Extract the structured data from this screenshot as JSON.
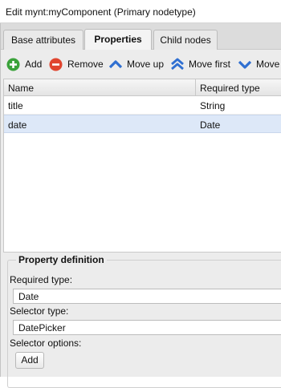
{
  "window": {
    "title": "Edit mynt:myComponent (Primary nodetype)"
  },
  "tabs": [
    {
      "label": "Base attributes",
      "active": false
    },
    {
      "label": "Properties",
      "active": true
    },
    {
      "label": "Child nodes",
      "active": false
    }
  ],
  "toolbar": {
    "add": {
      "label": "Add",
      "icon": "plus-circle-icon",
      "color": "#3aa23a"
    },
    "remove": {
      "label": "Remove",
      "icon": "minus-circle-icon",
      "color": "#e0452f"
    },
    "move_up": {
      "label": "Move up",
      "icon": "chevron-up-icon",
      "color": "#2f6fd1"
    },
    "move_first": {
      "label": "Move first",
      "icon": "double-chevron-up-icon",
      "color": "#2f6fd1"
    },
    "move_down": {
      "label": "Move",
      "icon": "chevron-down-icon",
      "color": "#2f6fd1"
    }
  },
  "grid": {
    "columns": [
      "Name",
      "Required type"
    ],
    "rows": [
      {
        "name": "title",
        "type": "String",
        "selected": false
      },
      {
        "name": "date",
        "type": "Date",
        "selected": true
      }
    ]
  },
  "property_definition": {
    "legend": "Property definition",
    "required_type_label": "Required type:",
    "required_type_value": "Date",
    "selector_type_label": "Selector type:",
    "selector_type_value": "DatePicker",
    "selector_options_label": "Selector options:",
    "add_button": "Add"
  }
}
